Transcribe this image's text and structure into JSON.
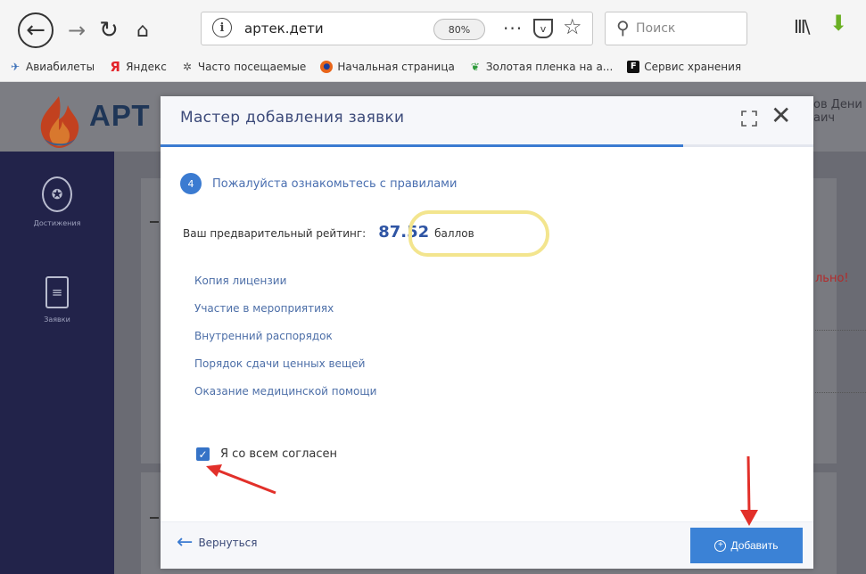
{
  "browser": {
    "url": "артек.дети",
    "zoom": "80%",
    "search_placeholder": "Поиск",
    "bookmarks": [
      {
        "label": "Авиабилеты",
        "icon": "plane-icon"
      },
      {
        "label": "Яндекс",
        "icon": "yandex-icon"
      },
      {
        "label": "Часто посещаемые",
        "icon": "gear-icon"
      },
      {
        "label": "Начальная страница",
        "icon": "firefox-icon"
      },
      {
        "label": "Золотая пленка на а...",
        "icon": "leaf-icon"
      },
      {
        "label": "Сервис хранения",
        "icon": "f-box-icon"
      }
    ]
  },
  "site": {
    "logo_text": "АРТ",
    "user_name_line1": "ов Дени",
    "user_name_line2": "аич",
    "sidebar": [
      {
        "label": "Достижения",
        "icon": "award-icon"
      },
      {
        "label": "Заявки",
        "icon": "document-icon"
      }
    ],
    "warning_text": "льно!"
  },
  "modal": {
    "title": "Мастер добавления заявки",
    "progress_fraction": 0.8,
    "step_number": "4",
    "step_title": "Пожалуйста ознакомьтесь с правилами",
    "rating_label": "Ваш предварительный рейтинг:",
    "rating_value": "87.52",
    "rating_unit": "баллов",
    "rules": [
      "Копия лицензии",
      "Участие в мероприятиях",
      "Внутренний распорядок",
      "Порядок сдачи ценных вещей",
      "Оказание медицинской помощи"
    ],
    "agree_label": "Я со всем согласен",
    "agree_checked": true,
    "back_label": "Вернуться",
    "add_label": "Добавить"
  },
  "colors": {
    "accent": "#3b82d6",
    "sidebar": "#22234a",
    "annotation": "#e2302a",
    "highlight": "#f3e58e"
  }
}
